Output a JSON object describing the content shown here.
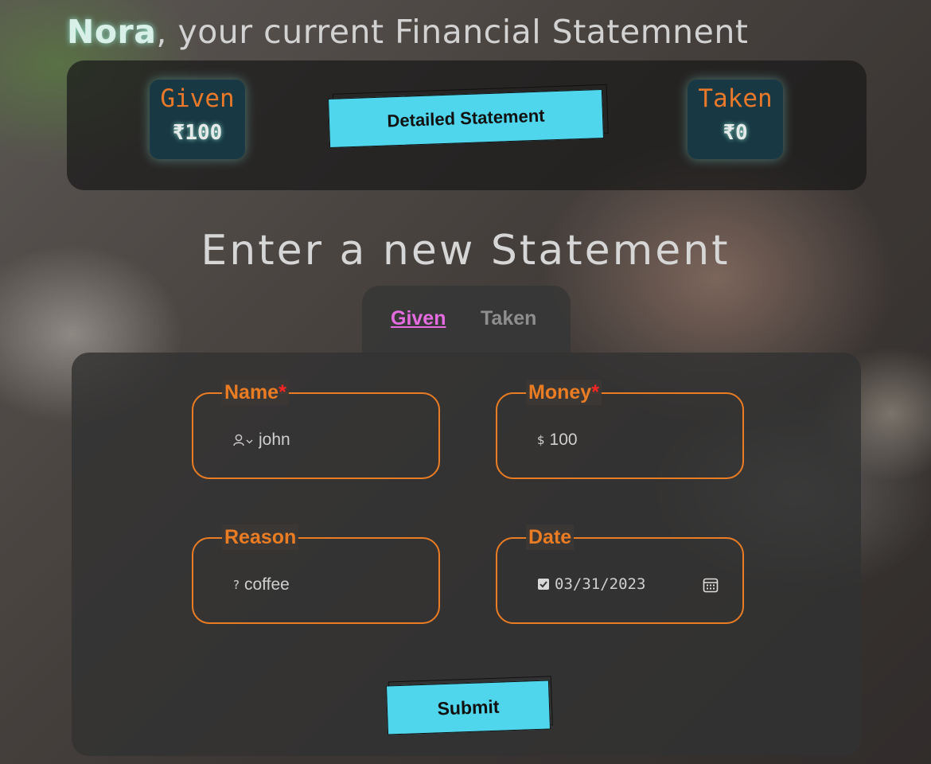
{
  "header": {
    "user_name": "Nora",
    "title_rest": ", your current Financial Statemnent"
  },
  "summary": {
    "given_label": "Given",
    "given_value": "₹100",
    "taken_label": "Taken",
    "taken_value": "₹0",
    "detail_button_label": "Detailed Statement"
  },
  "section_title": "Enter a new Statement",
  "tabs": [
    {
      "label": "Given",
      "active": true
    },
    {
      "label": "Taken",
      "active": false
    }
  ],
  "form": {
    "name": {
      "label": "Name",
      "required_mark": "*",
      "value": "john",
      "icon": "user-icon"
    },
    "money": {
      "label": "Money",
      "required_mark": "*",
      "prefix": "$",
      "value": "100"
    },
    "reason": {
      "label": "Reason",
      "prefix": "?",
      "value": "coffee"
    },
    "date": {
      "label": "Date",
      "value": "03/31/2023",
      "checked": true,
      "icon": "calendar-icon"
    },
    "submit_label": "Submit"
  },
  "colors": {
    "accent_orange": "#ea7c23",
    "button_cyan": "#4fd6ec",
    "active_tab": "#e46ce0",
    "required": "#ff2424"
  }
}
